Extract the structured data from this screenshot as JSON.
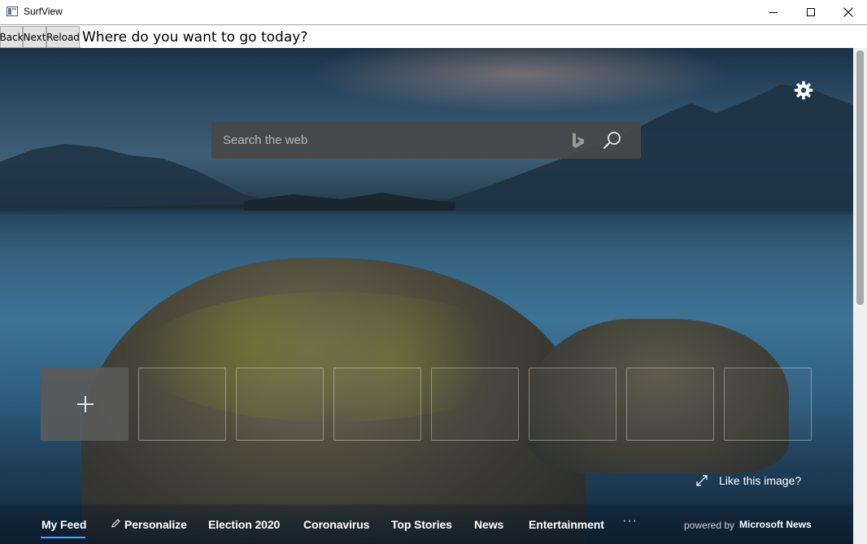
{
  "window": {
    "title": "SurfView",
    "app_icon": "app-window-icon",
    "controls": {
      "minimize": "minimize-icon",
      "maximize": "maximize-icon",
      "close": "close-icon"
    }
  },
  "toolbar": {
    "back_label": "Back",
    "next_label": "Next",
    "reload_label": "Reload",
    "address_value": "Where do you want to go today?"
  },
  "newtab": {
    "settings_icon": "gear-icon",
    "search": {
      "placeholder": "Search the web",
      "bing_icon": "bing-logo-icon",
      "search_icon": "magnifier-icon"
    },
    "quick_links": {
      "add_icon": "plus-icon",
      "empty_tile_count": 7
    },
    "like_image_label": "Like this image?",
    "nav": {
      "items": [
        "My Feed",
        "Personalize",
        "Election 2020",
        "Coronavirus",
        "Top Stories",
        "News",
        "Entertainment"
      ],
      "active_item": "My Feed",
      "more_label": "···",
      "powered_by": "powered by",
      "provider": "Microsoft News"
    }
  },
  "colors": {
    "accent_underline": "#4aa3ff",
    "search_bg": "#484848",
    "tile_add_bg": "#5a5a5a"
  }
}
